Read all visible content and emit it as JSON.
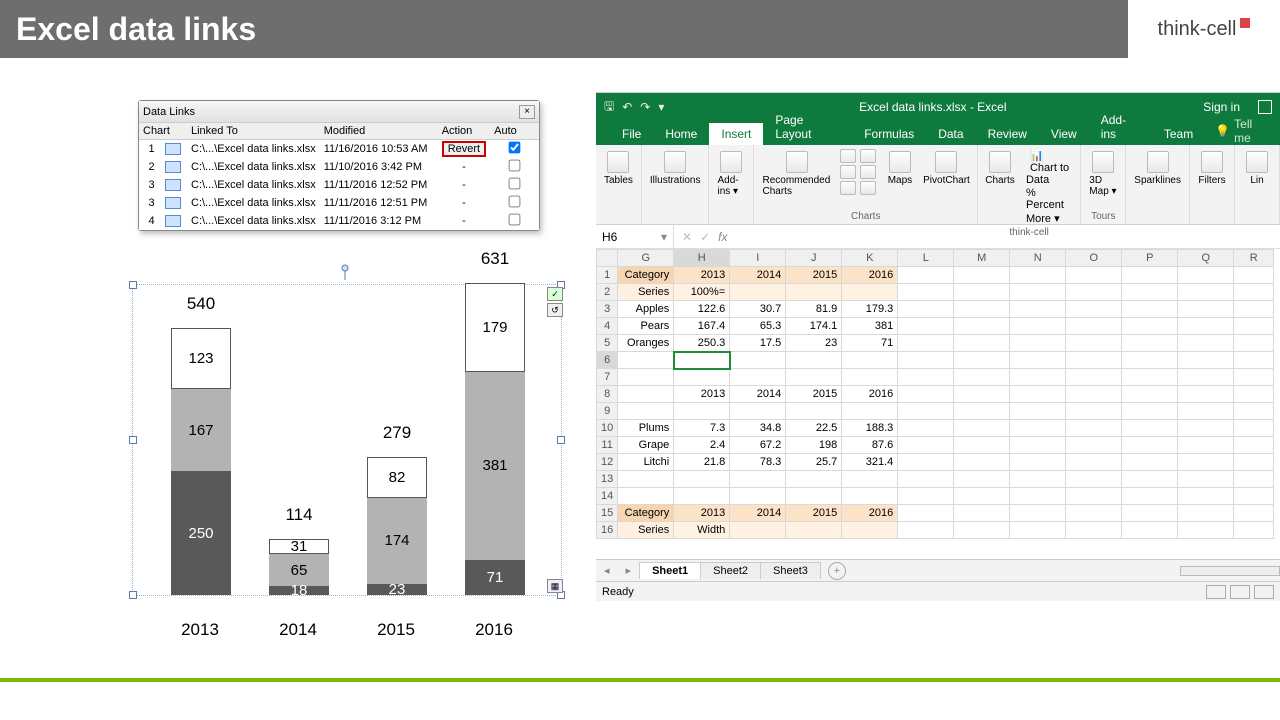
{
  "title": "Excel data links",
  "logo_text": "think-cell",
  "dialog": {
    "title": "Data Links",
    "close": "×",
    "cols": {
      "chart": "Chart",
      "linked": "Linked To",
      "modified": "Modified",
      "action": "Action",
      "auto": "Auto"
    },
    "revert_label": "Revert",
    "rows": [
      {
        "idx": "1",
        "path": "C:\\...\\Excel data links.xlsx",
        "mod": "11/16/2016 10:53 AM",
        "action": "revert",
        "auto": true
      },
      {
        "idx": "2",
        "path": "C:\\...\\Excel data links.xlsx",
        "mod": "11/10/2016 3:42 PM",
        "action": "-",
        "auto": false
      },
      {
        "idx": "3",
        "path": "C:\\...\\Excel data links.xlsx",
        "mod": "11/11/2016 12:52 PM",
        "action": "-",
        "auto": false
      },
      {
        "idx": "3",
        "path": "C:\\...\\Excel data links.xlsx",
        "mod": "11/11/2016 12:51 PM",
        "action": "-",
        "auto": false
      },
      {
        "idx": "4",
        "path": "C:\\...\\Excel data links.xlsx",
        "mod": "11/11/2016 3:12 PM",
        "action": "-",
        "auto": false
      }
    ]
  },
  "chart_data": {
    "type": "bar",
    "stacked": true,
    "categories": [
      "2013",
      "2014",
      "2015",
      "2016"
    ],
    "series": [
      {
        "name": "Apples",
        "values": [
          123,
          31,
          82,
          179
        ]
      },
      {
        "name": "Pears",
        "values": [
          167,
          65,
          174,
          381
        ]
      },
      {
        "name": "Oranges",
        "values": [
          250,
          18,
          23,
          71
        ]
      }
    ],
    "totals": [
      540,
      114,
      279,
      631
    ],
    "ylim": [
      0,
      631
    ]
  },
  "excel": {
    "title": "Excel data links.xlsx - Excel",
    "signin": "Sign in",
    "tabs": [
      "File",
      "Home",
      "Insert",
      "Page Layout",
      "Formulas",
      "Data",
      "Review",
      "View",
      "Add-ins",
      "Team"
    ],
    "active_tab": "Insert",
    "tellme": "Tell me",
    "ribbon": {
      "tables": "Tables",
      "illus": "Illustrations",
      "addins": "Add-ins ▾",
      "reccharts": "Recommended Charts",
      "charts_label": "Charts",
      "maps": "Maps",
      "pivotchart": "PivotChart",
      "charts": "Charts",
      "tc_c2d": "Chart to Data",
      "tc_pct": "% Percent",
      "tc_more": "More ▾",
      "tc_label": "think-cell",
      "map3d": "3D Map ▾",
      "tours": "Tours",
      "spark": "Sparklines",
      "filters": "Filters",
      "link": "Lin"
    },
    "namebox": "H6",
    "fx": "fx",
    "col_headers": [
      "G",
      "H",
      "I",
      "J",
      "K",
      "L",
      "M",
      "N",
      "O",
      "P",
      "Q",
      "R"
    ],
    "row_headers": [
      "1",
      "2",
      "3",
      "4",
      "5",
      "6",
      "7",
      "8",
      "9",
      "10",
      "11",
      "12",
      "13",
      "14",
      "15",
      "16"
    ],
    "block1": {
      "cat": "Category",
      "pct": "100%=",
      "ser": "Series",
      "years": [
        "2013",
        "2014",
        "2015",
        "2016"
      ],
      "rows": [
        {
          "name": "Apples",
          "v": [
            "122.6",
            "30.7",
            "81.9",
            "179.3"
          ]
        },
        {
          "name": "Pears",
          "v": [
            "167.4",
            "65.3",
            "174.1",
            "381"
          ]
        },
        {
          "name": "Oranges",
          "v": [
            "250.3",
            "17.5",
            "23",
            "71"
          ]
        }
      ]
    },
    "block2": {
      "years": [
        "2013",
        "2014",
        "2015",
        "2016"
      ],
      "rows": [
        {
          "name": "Plums",
          "v": [
            "7.3",
            "34.8",
            "22.5",
            "188.3"
          ]
        },
        {
          "name": "Grape",
          "v": [
            "2.4",
            "67.2",
            "198",
            "87.6"
          ]
        },
        {
          "name": "Litchi",
          "v": [
            "21.8",
            "78.3",
            "25.7",
            "321.4"
          ]
        }
      ]
    },
    "block3": {
      "cat": "Category",
      "wid": "Width",
      "ser": "Series",
      "years": [
        "2013",
        "2014",
        "2015",
        "2016"
      ]
    },
    "sheets": [
      "Sheet1",
      "Sheet2",
      "Sheet3"
    ],
    "active_sheet": "Sheet1",
    "status": "Ready"
  }
}
